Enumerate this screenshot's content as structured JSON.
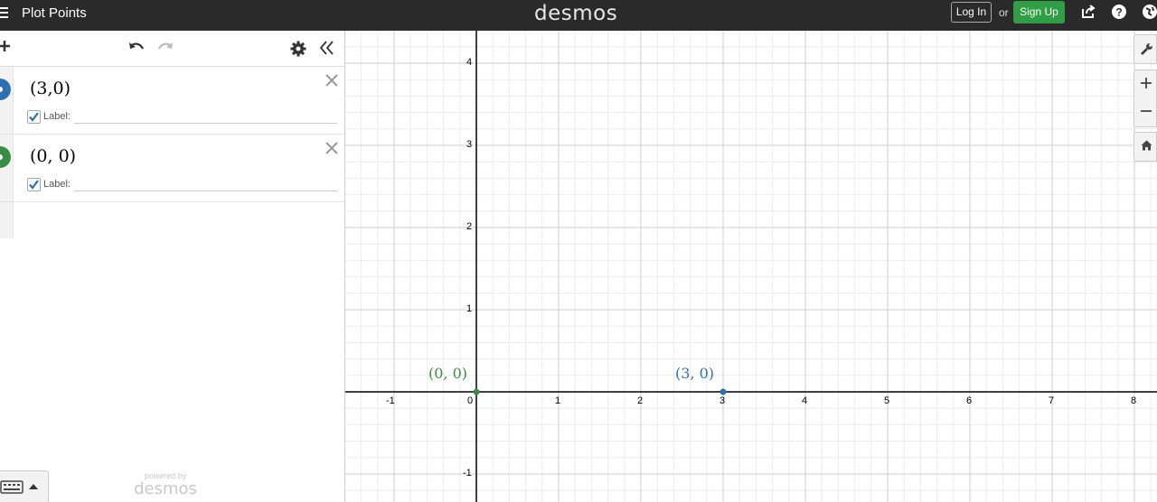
{
  "header": {
    "graph_title": "Plot Points",
    "logo": "desmos",
    "login_label": "Log In",
    "or_label": "or",
    "signup_label": "Sign Up",
    "signup_color": "#2f9e44"
  },
  "expressions": [
    {
      "latex": "(3,0)",
      "color": "#2d70b3",
      "label_checkbox": "Label:",
      "label_value": ""
    },
    {
      "latex": "(0, 0)",
      "color": "#388c46",
      "label_checkbox": "Label:",
      "label_value": ""
    }
  ],
  "branding": {
    "powered_by": "powered by",
    "logo": "desmos"
  },
  "graph": {
    "x_ticks": [
      "-1",
      "0",
      "1",
      "2",
      "3",
      "4",
      "5",
      "6",
      "7",
      "8"
    ],
    "y_ticks": [
      "4",
      "3",
      "2",
      "1",
      "-1"
    ],
    "points": [
      {
        "label": "(3, 0)",
        "x": 3,
        "y": 0,
        "color": "#2d70b3"
      },
      {
        "label": "(0, 0)",
        "x": 0,
        "y": 0,
        "color": "#388c46"
      }
    ]
  },
  "icons": {
    "menu": "hamburger-icon",
    "share": "share-icon",
    "help": "help-icon",
    "language": "globe-icon",
    "add": "plus-icon",
    "undo": "undo-icon",
    "redo": "redo-icon",
    "settings": "gear-icon",
    "collapse": "double-chevron-left-icon",
    "wrench": "wrench-icon",
    "zoom_in": "plus-icon",
    "zoom_out": "minus-icon",
    "home": "home-icon",
    "keyboard": "keyboard-icon"
  }
}
